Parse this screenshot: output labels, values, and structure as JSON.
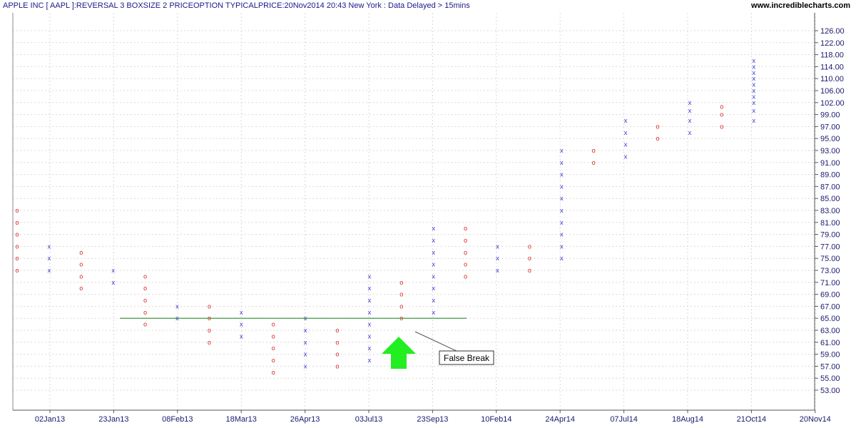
{
  "header": {
    "title": "APPLE INC [ AAPL ]:REVERSAL 3 BOXSIZE 2 PRICEOPTION TYPICALPRICE:20Nov2014 20:43 New York : Data Delayed > 15mins",
    "site": "www.incrediblecharts.com"
  },
  "colors": {
    "x_mark": "#3333cc",
    "o_mark": "#e02020",
    "support_line": "#2e8b2e",
    "arrow": "#22ee22"
  },
  "chart_data": {
    "type": "point-and-figure",
    "box_size": 2,
    "reversal": 3,
    "y_ticks": [
      "126.00",
      "122.00",
      "118.00",
      "114.00",
      "110.00",
      "106.00",
      "102.00",
      "99.00",
      "97.00",
      "95.00",
      "93.00",
      "91.00",
      "89.00",
      "87.00",
      "85.00",
      "83.00",
      "81.00",
      "79.00",
      "77.00",
      "75.00",
      "73.00",
      "71.00",
      "69.00",
      "67.00",
      "65.00",
      "63.00",
      "61.00",
      "59.00",
      "57.00",
      "55.00",
      "53.00"
    ],
    "x_labels": [
      "02Jan13",
      "23Jan13",
      "08Feb13",
      "18Mar13",
      "26Apr13",
      "03Jul13",
      "23Sep13",
      "10Feb14",
      "24Apr14",
      "07Jul14",
      "18Aug14",
      "21Oct14",
      "20Nov14"
    ],
    "columns": [
      {
        "type": "O",
        "from": 83,
        "to": 73
      },
      {
        "type": "X",
        "from": 73,
        "to": 78
      },
      {
        "type": "O",
        "from": 77,
        "to": 70
      },
      {
        "type": "X",
        "from": 71,
        "to": 73
      },
      {
        "type": "O",
        "from": 72,
        "to": 64
      },
      {
        "type": "X",
        "from": 65,
        "to": 68
      },
      {
        "type": "O",
        "from": 67,
        "to": 61
      },
      {
        "type": "X",
        "from": 62,
        "to": 66
      },
      {
        "type": "O",
        "from": 65,
        "to": 56
      },
      {
        "type": "X",
        "from": 57,
        "to": 65
      },
      {
        "type": "O",
        "from": 64,
        "to": 57
      },
      {
        "type": "X",
        "from": 58,
        "to": 72
      },
      {
        "type": "O",
        "from": 71,
        "to": 65
      },
      {
        "type": "X",
        "from": 66,
        "to": 81
      },
      {
        "type": "O",
        "from": 80,
        "to": 72
      },
      {
        "type": "X",
        "from": 73,
        "to": 78
      },
      {
        "type": "O",
        "from": 77,
        "to": 73
      },
      {
        "type": "X",
        "from": 75,
        "to": 94
      },
      {
        "type": "O",
        "from": 93,
        "to": 91
      },
      {
        "type": "X",
        "from": 92,
        "to": 98
      },
      {
        "type": "O",
        "from": 97,
        "to": 95
      },
      {
        "type": "X",
        "from": 96,
        "to": 102
      },
      {
        "type": "O",
        "from": 101,
        "to": 97
      },
      {
        "type": "X",
        "from": 98,
        "to": 116
      }
    ],
    "support_line": {
      "price": 65
    },
    "annotation": {
      "text": "False Break"
    }
  }
}
